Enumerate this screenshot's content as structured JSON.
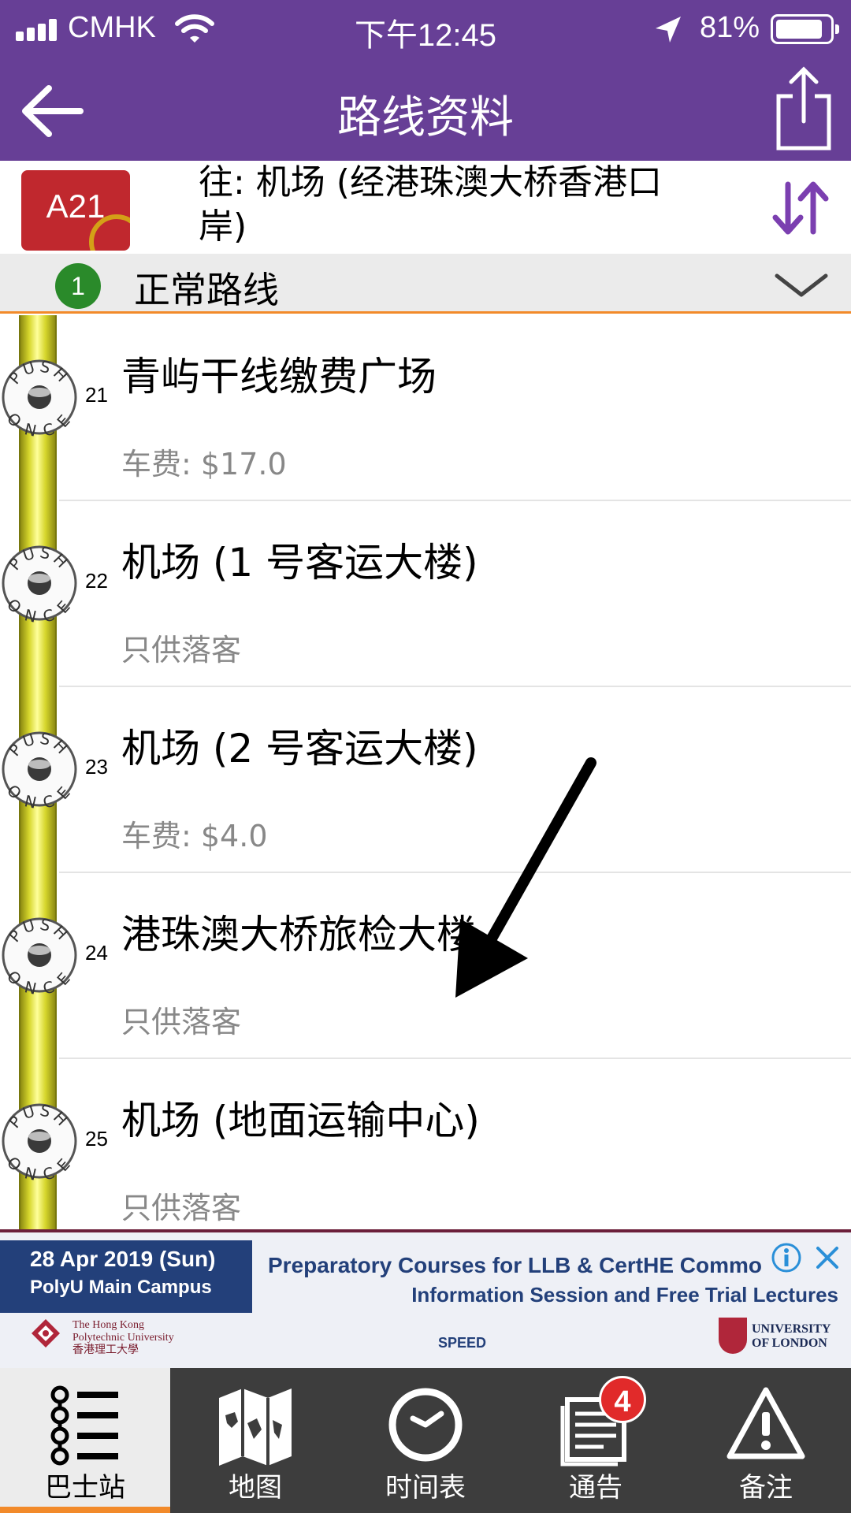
{
  "status_bar": {
    "carrier": "CMHK",
    "time": "下午12:45",
    "battery": "81%",
    "battery_level": 0.81
  },
  "nav": {
    "title": "路线资料"
  },
  "route": {
    "number": "A21",
    "destination": "往: 机场 (经港珠澳大桥香港口岸)"
  },
  "variant": {
    "number": "1",
    "label": "正常路线"
  },
  "push_button": {
    "top": "PUSH",
    "bottom": "ONCE"
  },
  "stops": [
    {
      "seq": "21",
      "name": "青屿干线缴费广场",
      "note": "车费: $17.0"
    },
    {
      "seq": "22",
      "name": "机场 (1 号客运大楼)",
      "note": "只供落客"
    },
    {
      "seq": "23",
      "name": "机场 (2 号客运大楼)",
      "note": "车费: $4.0"
    },
    {
      "seq": "24",
      "name": "港珠澳大桥旅检大楼",
      "note": "只供落客"
    },
    {
      "seq": "25",
      "name": "机场 (地面运输中心)",
      "note": "只供落客"
    }
  ],
  "ad": {
    "date": "28 Apr 2019 (Sun)",
    "venue": "PolyU Main Campus",
    "line1": "Preparatory Courses for LLB & CertHE Commo",
    "line2": "Information Session and Free Trial Lectures",
    "polyu_name_1": "The Hong Kong",
    "polyu_name_2": "Polytechnic University",
    "polyu_name_3": "香港理工大學",
    "speed": "SPEED",
    "uol_name_1": "UNIVERSITY",
    "uol_name_2": "OF LONDON"
  },
  "tabs": [
    {
      "label": "巴士站",
      "icon": "bus-stops-icon",
      "active": true
    },
    {
      "label": "地图",
      "icon": "map-icon",
      "active": false
    },
    {
      "label": "时间表",
      "icon": "clock-icon",
      "active": false
    },
    {
      "label": "通告",
      "icon": "notice-icon",
      "active": false,
      "badge": "4"
    },
    {
      "label": "备注",
      "icon": "warning-icon",
      "active": false
    }
  ],
  "colors": {
    "header_purple": "#673f96",
    "route_badge_red": "#c0282e",
    "accent_orange": "#f28a2a",
    "variant_green": "#2a8a2a",
    "badge_red": "#e12a2a"
  }
}
